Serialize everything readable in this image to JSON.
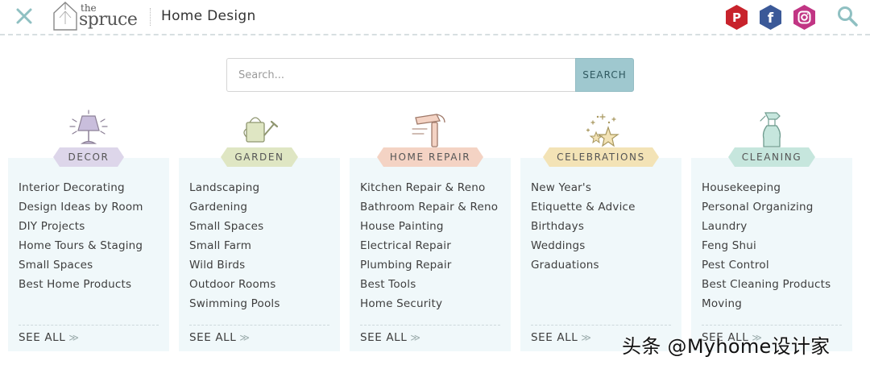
{
  "header": {
    "logo_the": "the",
    "logo_spruce": "spruce",
    "section_title": "Home Design"
  },
  "social": {
    "pinterest_letter": "P",
    "facebook_letter": "f",
    "colors": {
      "pinterest": "#c8232c",
      "facebook": "#3b5998",
      "instagram": "#c13584"
    }
  },
  "search": {
    "placeholder": "Search...",
    "button_label": "SEARCH"
  },
  "columns": [
    {
      "label": "DECOR",
      "ribbon_color": "#ddd6ea",
      "links": [
        "Interior Decorating",
        "Design Ideas by Room",
        "DIY Projects",
        "Home Tours & Staging",
        "Small Spaces",
        "Best Home Products"
      ],
      "see_all": "SEE ALL"
    },
    {
      "label": "GARDEN",
      "ribbon_color": "#dfe6c3",
      "links": [
        "Landscaping",
        "Gardening",
        "Small Spaces",
        "Small Farm",
        "Wild Birds",
        "Outdoor Rooms",
        "Swimming Pools"
      ],
      "see_all": "SEE ALL"
    },
    {
      "label": "HOME REPAIR",
      "ribbon_color": "#f4d3c4",
      "links": [
        "Kitchen Repair & Reno",
        "Bathroom Repair & Reno",
        "House Painting",
        "Electrical Repair",
        "Plumbing Repair",
        "Best Tools",
        "Home Security"
      ],
      "see_all": "SEE ALL"
    },
    {
      "label": "CELEBRATIONS",
      "ribbon_color": "#f3e3b6",
      "links": [
        "New Year's",
        "Etiquette & Advice",
        "Birthdays",
        "Weddings",
        "Graduations"
      ],
      "see_all": "SEE ALL"
    },
    {
      "label": "CLEANING",
      "ribbon_color": "#c6e6dd",
      "links": [
        "Housekeeping",
        "Personal Organizing",
        "Laundry",
        "Feng Shui",
        "Pest Control",
        "Best Cleaning Products",
        "Moving"
      ],
      "see_all": "SEE ALL"
    }
  ],
  "watermark": "头条 @Myhome设计家"
}
